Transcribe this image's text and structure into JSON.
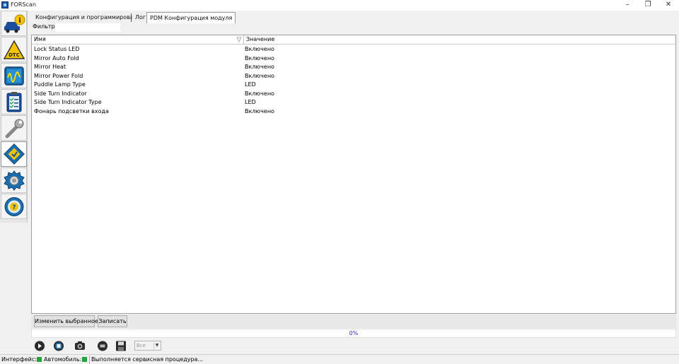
{
  "window": {
    "title": "FORScan",
    "minimize": "–",
    "restore": "❐",
    "close": "✕"
  },
  "sidebar": {
    "items": [
      {
        "icon": "car-info-icon"
      },
      {
        "icon": "dtc-icon"
      },
      {
        "icon": "oscilloscope-icon"
      },
      {
        "icon": "checklist-icon"
      },
      {
        "icon": "wrench-icon"
      },
      {
        "icon": "module-config-icon",
        "active": true
      },
      {
        "icon": "settings-gear-icon"
      },
      {
        "icon": "help-icon"
      }
    ]
  },
  "tabs": [
    {
      "label": "Конфигурация и программирование"
    },
    {
      "label": "Лог"
    },
    {
      "label": "PDM Конфигурация модуля",
      "active": true
    }
  ],
  "filter": {
    "label": "Фильтр:",
    "value": ""
  },
  "table": {
    "columns": [
      "Имя",
      "Значение"
    ],
    "rows": [
      {
        "name": "Lock Status LED",
        "value": "Включено"
      },
      {
        "name": "Mirror Auto Fold",
        "value": "Включено"
      },
      {
        "name": "Mirror Heat",
        "value": "Включено"
      },
      {
        "name": "Mirror Power Fold",
        "value": "Включено"
      },
      {
        "name": "Puddle Lamp Type",
        "value": "LED"
      },
      {
        "name": "Side Turn Indicator",
        "value": "Включено"
      },
      {
        "name": "Side Turn Indicator Type",
        "value": "LED"
      },
      {
        "name": "Фонарь подсветки входа",
        "value": "Включено"
      }
    ]
  },
  "buttons": {
    "edit_selected": "Изменить выбранное",
    "write": "Записать"
  },
  "progress": {
    "text": "0%",
    "value": 0
  },
  "controls": {
    "select_value": "Все"
  },
  "status": {
    "interface_label": "Интерфейс:",
    "vehicle_label": "Автомобиль:",
    "message": "Выполняется сервисная процедура...",
    "led_color": "#1fa33a"
  }
}
